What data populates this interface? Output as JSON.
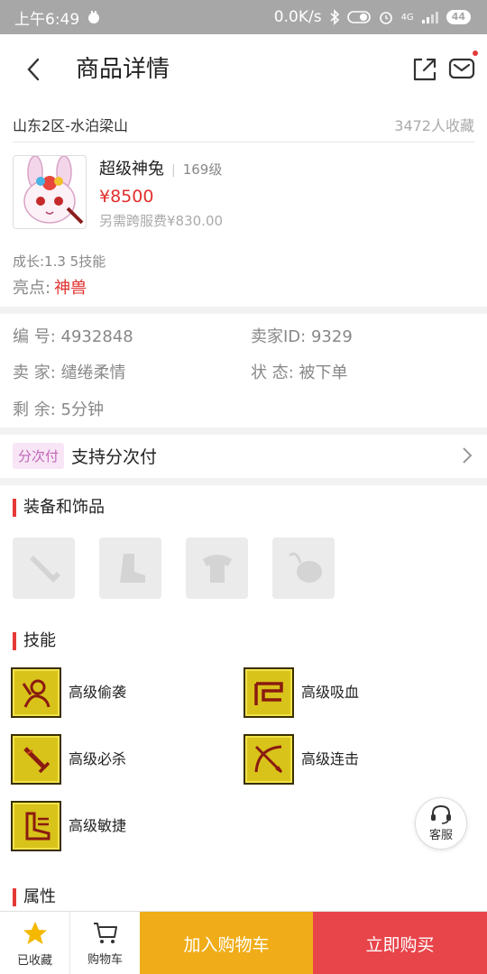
{
  "status_bar": {
    "time": "上午6:49",
    "speed": "0.0K/s",
    "network": "4G",
    "battery": "44"
  },
  "header": {
    "title": "商品详情"
  },
  "server": {
    "name": "山东2区-水泊梁山",
    "favorites": "3472人收藏"
  },
  "pet": {
    "name": "超级神兔",
    "level": "169级",
    "price": "¥8500",
    "fee": "另需跨服费¥830.00",
    "growth": "成长:1.3 5技能",
    "highlight_label": "亮点:",
    "highlight_value": "神兽"
  },
  "info": {
    "id_label": "编  号:",
    "id_value": "4932848",
    "seller_id_label": "卖家ID:",
    "seller_id_value": "9329",
    "seller_label": "卖  家:",
    "seller_value": "缱绻柔情",
    "status_label": "状  态:",
    "status_value": "被下单",
    "remain_label": "剩  余:",
    "remain_value": "5分钟"
  },
  "installment": {
    "tag": "分次付",
    "text": "支持分次付"
  },
  "sections": {
    "equipment": "装备和饰品",
    "skills": "技能",
    "attributes": "属性"
  },
  "equipment_slots": [
    "weapon-slot-icon",
    "boots-slot-icon",
    "armor-slot-icon",
    "accessory-slot-icon"
  ],
  "skills": [
    {
      "label": "高级偷袭",
      "icon": "sneak-attack-icon"
    },
    {
      "label": "高级吸血",
      "icon": "blood-suck-icon"
    },
    {
      "label": "高级必杀",
      "icon": "critical-strike-icon"
    },
    {
      "label": "高级连击",
      "icon": "combo-attack-icon"
    },
    {
      "label": "高级敏捷",
      "icon": "agility-icon"
    }
  ],
  "service": {
    "label": "客服"
  },
  "bottom_bar": {
    "favorited_label": "已收藏",
    "cart_label": "购物车",
    "add_to_cart": "加入购物车",
    "buy_now": "立即购买"
  },
  "colors": {
    "accent_red": "#e0302e",
    "cart_button": "#f0ad19",
    "buy_button": "#e8454b",
    "favorite_star": "#f5b800"
  }
}
